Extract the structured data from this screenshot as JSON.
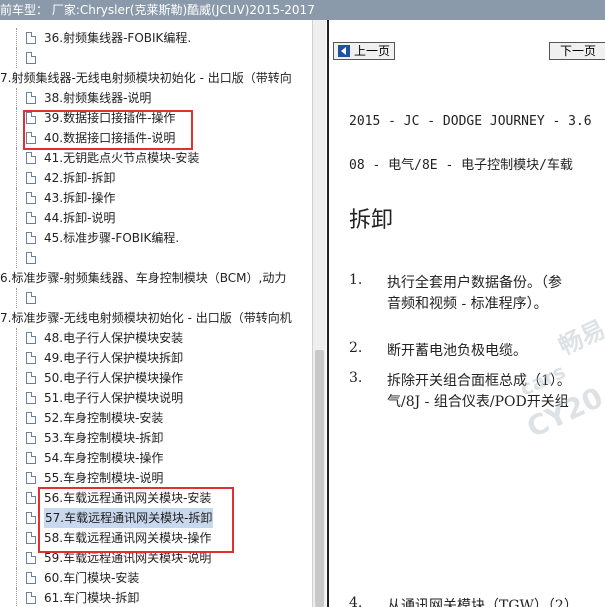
{
  "title": "前车型： 厂家:Chrysler(克莱斯勒)酷威(JCUV)2015-2017",
  "tree": {
    "rows": [
      {
        "indent": 2,
        "icon": true,
        "text": "36.射频集线器-FOBIK编程."
      },
      {
        "indent": 2,
        "icon": true,
        "text": ""
      },
      {
        "indent": 0,
        "icon": false,
        "text": "7.射频集线器-无线电射频模块初始化 - 出口版（带转向"
      },
      {
        "indent": 2,
        "icon": true,
        "text": "38.射频集线器-说明"
      },
      {
        "indent": 2,
        "icon": true,
        "text": "39.数据接口接插件-操作"
      },
      {
        "indent": 2,
        "icon": true,
        "text": "40.数据接口接插件-说明"
      },
      {
        "indent": 2,
        "icon": true,
        "text": "41.无钥匙点火节点模块-安装"
      },
      {
        "indent": 2,
        "icon": true,
        "text": "42.拆卸-拆卸"
      },
      {
        "indent": 2,
        "icon": true,
        "text": "43.拆卸-操作"
      },
      {
        "indent": 2,
        "icon": true,
        "text": "44.拆卸-说明"
      },
      {
        "indent": 2,
        "icon": true,
        "text": "45.标准步骤-FOBIK编程."
      },
      {
        "indent": 2,
        "icon": true,
        "text": ""
      },
      {
        "indent": 0,
        "icon": false,
        "text": "6.标准步骤-射频集线器、车身控制模块（BCM）,动力"
      },
      {
        "indent": 2,
        "icon": true,
        "text": ""
      },
      {
        "indent": 0,
        "icon": false,
        "text": "7.标准步骤-无线电射频模块初始化 - 出口版（带转向机"
      },
      {
        "indent": 2,
        "icon": true,
        "text": "48.电子行人保护模块安装"
      },
      {
        "indent": 2,
        "icon": true,
        "text": "49.电子行人保护模块拆卸"
      },
      {
        "indent": 2,
        "icon": true,
        "text": "50.电子行人保护模块操作"
      },
      {
        "indent": 2,
        "icon": true,
        "text": "51.电子行人保护模块说明"
      },
      {
        "indent": 2,
        "icon": true,
        "text": "52.车身控制模块-安装"
      },
      {
        "indent": 2,
        "icon": true,
        "text": "53.车身控制模块-拆卸"
      },
      {
        "indent": 2,
        "icon": true,
        "text": "54.车身控制模块-操作"
      },
      {
        "indent": 2,
        "icon": true,
        "text": "55.车身控制模块-说明"
      },
      {
        "indent": 2,
        "icon": true,
        "text": "56.车载远程通讯网关模块-安装"
      },
      {
        "indent": 2,
        "icon": true,
        "text": "57.车载远程通讯网关模块-拆卸",
        "selected": true
      },
      {
        "indent": 2,
        "icon": true,
        "text": "58.车载远程通讯网关模块-操作"
      },
      {
        "indent": 2,
        "icon": true,
        "text": "59.车载远程通讯网关模块-说明"
      },
      {
        "indent": 2,
        "icon": true,
        "text": "60.车门模块-安装"
      },
      {
        "indent": 2,
        "icon": true,
        "text": "61.车门模块-拆卸"
      }
    ]
  },
  "nav": {
    "prev_label": "上一页",
    "next_label": "下一页"
  },
  "doc": {
    "model_line": "2015 - JC - DODGE JOURNEY - 3.6",
    "section_line": "08 - 电气/8E - 电子控制模块/车载",
    "heading": "拆卸",
    "steps": [
      {
        "num": "1.",
        "lines": [
          "执行全套用户数据备份。（参",
          "音频和视频 - 标准程序）。"
        ]
      },
      {
        "num": "2.",
        "lines": [
          "断开蓄电池负极电缆。"
        ]
      },
      {
        "num": "3.",
        "lines": [
          "拆除开关组合面框总成（1）。",
          "气/8J - 组合仪表/POD开关组"
        ]
      },
      {
        "num": "4.",
        "lines": [
          "从通讯网关模块（TGW）（2）"
        ]
      }
    ]
  },
  "watermark": {
    "line1": "畅易",
    "line2": "cars",
    "line3": "CY20"
  }
}
